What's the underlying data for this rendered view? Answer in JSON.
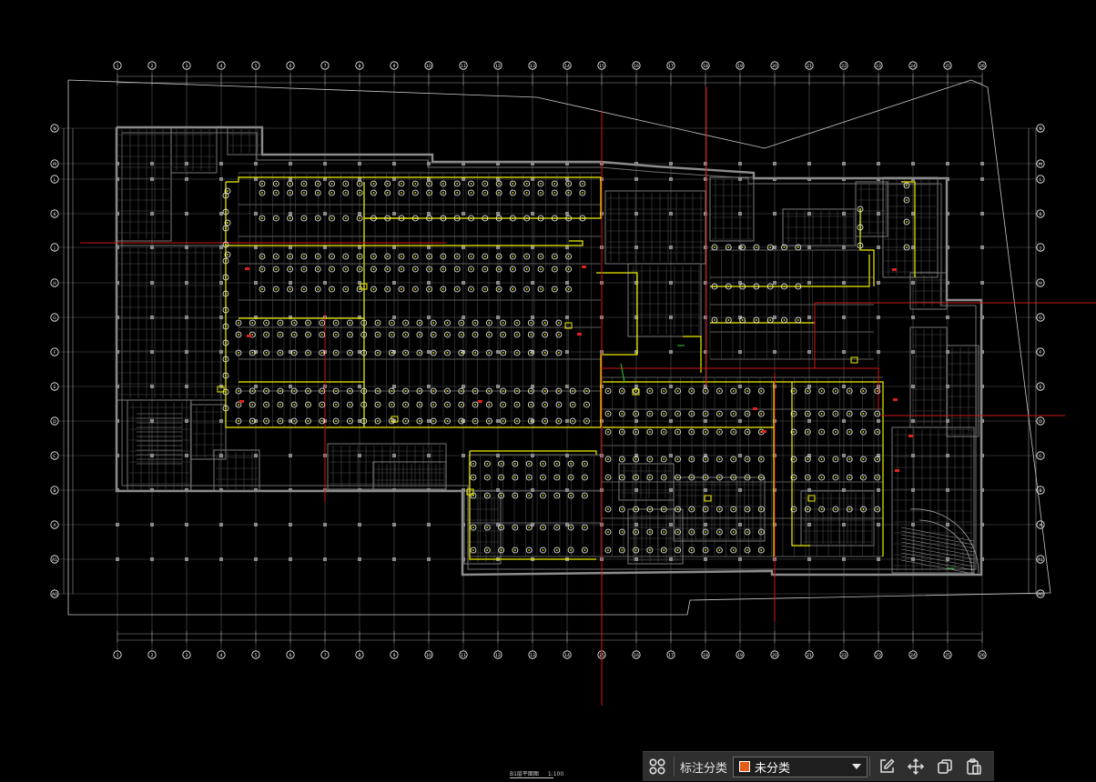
{
  "drawing": {
    "background": "#000000",
    "grid_labels_top": [
      "1",
      "2",
      "3",
      "4",
      "5",
      "6",
      "7",
      "8",
      "9",
      "10",
      "11",
      "12",
      "13",
      "14",
      "15",
      "16",
      "17",
      "18",
      "19",
      "20",
      "21",
      "22",
      "23",
      "24",
      "25",
      "26"
    ],
    "grid_labels_side": [
      "N",
      "M",
      "L",
      "K",
      "J",
      "H",
      "G",
      "F",
      "E",
      "D",
      "C",
      "B",
      "A",
      "A1",
      "A0"
    ],
    "sheet_title": "B1层平面图",
    "sheet_scale": "1:100",
    "colors": {
      "walls": "#8c8c8c",
      "grid": "#ffffff",
      "axis_line": "#d01818",
      "fixture": "#ffffff",
      "pipe": "#f0f000",
      "accent_red": "#e02020",
      "accent_green": "#2fae2f"
    }
  },
  "toolbar": {
    "grid_icon": "grid-four-circles-icon",
    "label": "标注分类",
    "select_value": "未分类",
    "select_color": "#e35d16",
    "icons": [
      "edit-icon",
      "move-icon",
      "copy-icon",
      "paste-icon"
    ]
  }
}
